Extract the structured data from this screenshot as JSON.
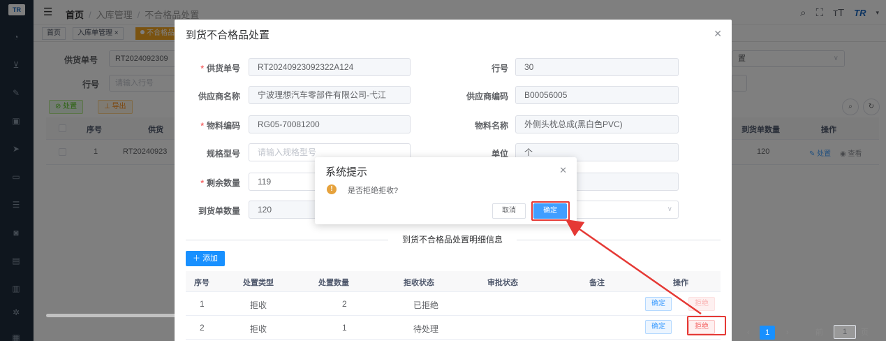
{
  "app": {
    "logo": "TR",
    "brand_mark": "TR"
  },
  "breadcrumb": [
    "首页",
    "入库管理",
    "不合格品处置"
  ],
  "tags": [
    "首页",
    "入库单管理",
    "不合格品"
  ],
  "tag_close": "×",
  "background_page": {
    "form": {
      "supply_no_label": "供货单号",
      "supply_no_value": "RT2024092309",
      "line_no_label": "行号",
      "line_no_placeholder": "请输入行号",
      "right_select_value": "置"
    },
    "buttons": {
      "dispose": "处置",
      "export": "导出"
    },
    "table": {
      "headers": [
        "序号",
        "供货",
        "到货单数量",
        "操作"
      ],
      "row": {
        "index": "1",
        "supply_no": "RT20240923",
        "qty": "120",
        "action_dispose": "处置",
        "action_view": "查看"
      }
    },
    "pagination": {
      "current_page": "1",
      "goto_label": "前往",
      "goto_value": "1",
      "page_unit": "页"
    }
  },
  "dialog": {
    "title": "到货不合格品处置",
    "fields": {
      "supply_no": {
        "label": "供货单号",
        "value": "RT20240923092322A124",
        "required": true
      },
      "line_no": {
        "label": "行号",
        "value": "30"
      },
      "supplier_name": {
        "label": "供应商名称",
        "value": "宁波理想汽车零部件有限公司-弋江"
      },
      "supplier_code": {
        "label": "供应商编码",
        "value": "B00056005"
      },
      "material_code": {
        "label": "物料编码",
        "value": "RG05-70081200",
        "required": true
      },
      "material_name": {
        "label": "物料名称",
        "value": "外侧头枕总成(黑白色PVC)"
      },
      "spec": {
        "label": "规格型号",
        "placeholder": "请输入规格型号"
      },
      "unit": {
        "label": "单位",
        "value": "个"
      },
      "remaining_qty": {
        "label": "剩余数量",
        "value": "119",
        "required": true
      },
      "arrival_qty": {
        "label": "到货单数量",
        "value": "120"
      }
    },
    "detail_section_title": "到货不合格品处置明细信息",
    "add_button": "添加",
    "detail_table": {
      "headers": [
        "序号",
        "处置类型",
        "处置数量",
        "拒收状态",
        "审批状态",
        "备注",
        "操作"
      ],
      "rows": [
        {
          "index": "1",
          "type": "拒收",
          "qty": "2",
          "reject_status": "已拒绝",
          "approve_status": "",
          "remark": "",
          "confirm": "确定",
          "reject": "拒绝"
        },
        {
          "index": "2",
          "type": "拒收",
          "qty": "1",
          "reject_status": "待处理",
          "approve_status": "",
          "remark": "",
          "confirm": "确定",
          "reject": "拒绝"
        }
      ]
    }
  },
  "message_box": {
    "title": "系统提示",
    "message": "是否拒绝拒收?",
    "cancel": "取消",
    "confirm": "确定"
  },
  "colors": {
    "sidebar": "#1f2d3d",
    "primary": "#409eff",
    "warning": "#e6a23c",
    "danger": "#f56c6c",
    "annotation_red": "#e53935"
  }
}
